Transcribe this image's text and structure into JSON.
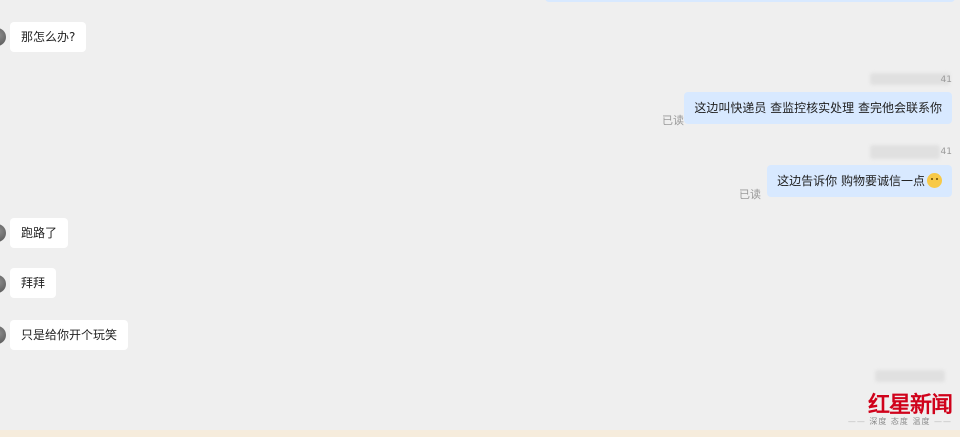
{
  "messages_incoming": [
    {
      "text": "那怎么办?"
    },
    {
      "text": "跑路了"
    },
    {
      "text": "拜拜"
    },
    {
      "text": "只是给你开个玩笑"
    }
  ],
  "messages_outgoing": [
    {
      "text": "这边叫快递员 查监控核实处理 查完他会联系你",
      "status": "已读"
    },
    {
      "text": "这边告诉你 购物要诚信一点",
      "status": "已读",
      "emoji": "smiling-face-emoji"
    }
  ],
  "timestamps": [
    "41",
    "41"
  ],
  "watermark": {
    "logo_main": "红星新闻",
    "tagline": "深度 态度 温度",
    "color": "#d0021b"
  },
  "colors": {
    "background": "#efefef",
    "incoming_bubble": "#ffffff",
    "outgoing_bubble": "#d8e9ff"
  }
}
